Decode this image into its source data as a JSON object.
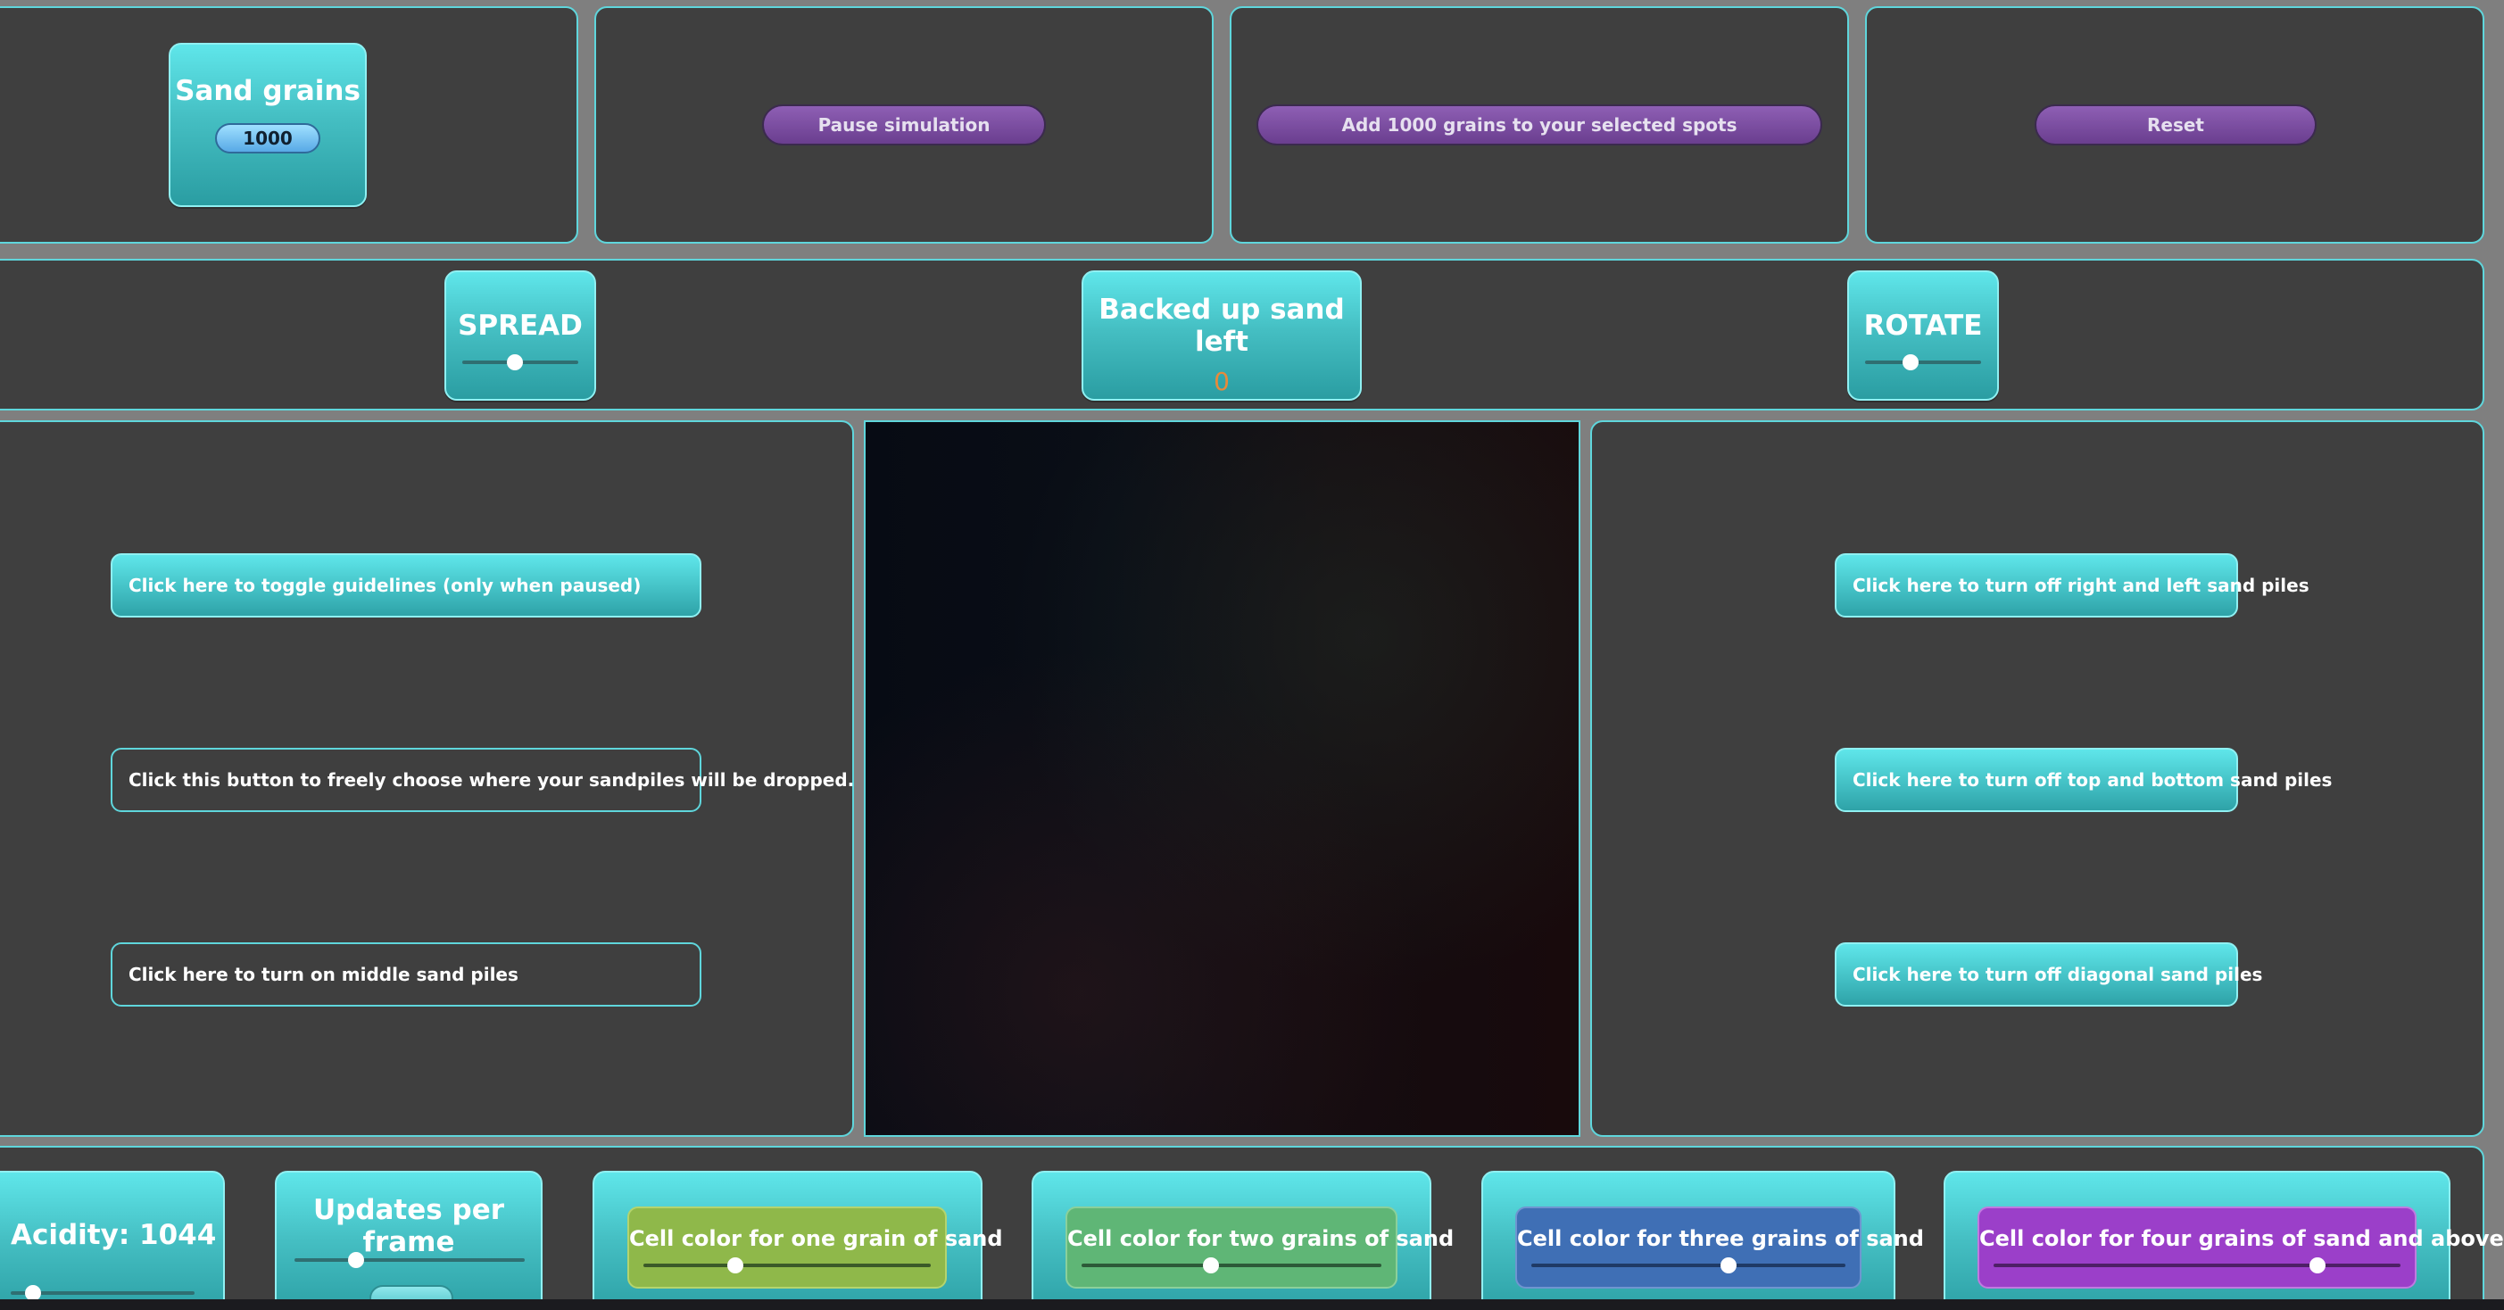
{
  "sand_grains": {
    "title": "Sand grains",
    "value": "1000"
  },
  "controls": {
    "pause_label": "Pause simulation",
    "add_label": "Add 1000 grains to your selected spots",
    "reset_label": "Reset"
  },
  "spread": {
    "label": "SPREAD",
    "value": 0.45
  },
  "backed_up": {
    "label": "Backed up sand left",
    "value": "0"
  },
  "rotate": {
    "label": "ROTATE",
    "value": 0.39
  },
  "left_buttons": [
    {
      "label": "Click here to toggle guidelines (only when paused)",
      "state": "on"
    },
    {
      "label": "Click this button to freely choose where your sandpiles will be dropped.",
      "state": "off"
    },
    {
      "label": "Click here to turn on middle sand piles",
      "state": "off"
    }
  ],
  "right_buttons": [
    {
      "label": "Click here to turn off right and left sand piles",
      "state": "on"
    },
    {
      "label": "Click here to turn off top and bottom sand piles",
      "state": "on"
    },
    {
      "label": "Click here to turn off diagonal sand piles",
      "state": "on"
    }
  ],
  "acidity": {
    "label": "Acidity: 1044"
  },
  "updates": {
    "label": "Updates per frame"
  },
  "cell_colors": [
    {
      "label": "Cell color for one grain of sand",
      "color": "#8fb84a",
      "value": 0.3
    },
    {
      "label": "Cell color for two grains of sand",
      "color": "#5fb676",
      "value": 0.5
    },
    {
      "label": "Cell color for three grains of sand",
      "color": "#3f6fb5",
      "value": 0.65
    },
    {
      "label": "Cell color for four grains of sand and above",
      "color": "#9b3fc9",
      "value": 0.77
    }
  ]
}
